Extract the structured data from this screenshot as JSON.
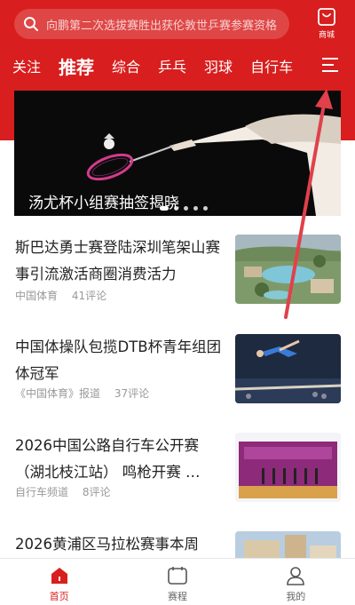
{
  "search": {
    "placeholder": "向鹏第二次选拔赛胜出获伦敦世乒赛参赛资格"
  },
  "mall": {
    "label": "商城"
  },
  "tabs": [
    {
      "label": "关注",
      "active": false
    },
    {
      "label": "推荐",
      "active": true
    },
    {
      "label": "综合",
      "active": false
    },
    {
      "label": "乒乓",
      "active": false
    },
    {
      "label": "羽球",
      "active": false
    },
    {
      "label": "自行车",
      "active": false
    }
  ],
  "banner": {
    "caption": "汤尤杯小组赛抽签揭晓",
    "dots": 5,
    "active_dot": 0
  },
  "news": [
    {
      "title": "斯巴达勇士赛登陆深圳笔架山赛事引流激活商圈消费活力",
      "source": "中国体育",
      "comments": "41评论",
      "thumb": "park-icon"
    },
    {
      "title": "中国体操队包揽DTB杯青年组团体冠军",
      "source": "《中国体育》报道",
      "comments": "37评论",
      "thumb": "gymnast-icon"
    },
    {
      "title": "2026中国公路自行车公开赛（湖北枝江站） 鸣枪开赛 …",
      "source": "自行车频道",
      "comments": "8评论",
      "thumb": "stage-icon"
    },
    {
      "title": "2026黄浦区马拉松赛事本周",
      "source": "",
      "comments": "",
      "thumb": "building-icon"
    }
  ],
  "bottom_nav": [
    {
      "label": "首页",
      "active": true,
      "icon": "home-icon"
    },
    {
      "label": "赛程",
      "active": false,
      "icon": "calendar-icon"
    },
    {
      "label": "我的",
      "active": false,
      "icon": "user-icon"
    }
  ],
  "colors": {
    "brand": "#d81e1e",
    "text": "#222222",
    "meta": "#999999"
  }
}
